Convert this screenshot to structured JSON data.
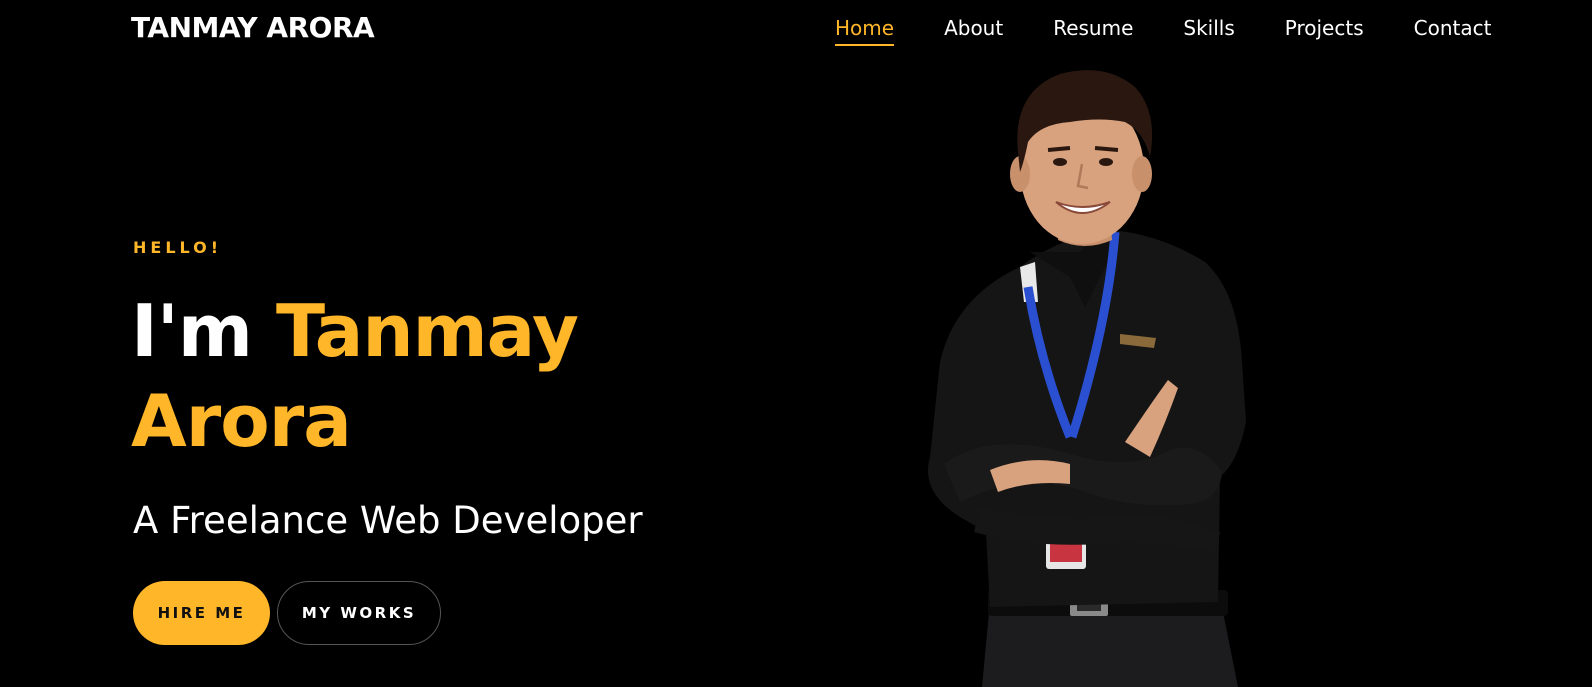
{
  "brand": {
    "name": "TANMAY ARORA"
  },
  "nav": {
    "items": [
      {
        "label": "Home",
        "active": true
      },
      {
        "label": "About",
        "active": false
      },
      {
        "label": "Resume",
        "active": false
      },
      {
        "label": "Skills",
        "active": false
      },
      {
        "label": "Projects",
        "active": false
      },
      {
        "label": "Contact",
        "active": false
      }
    ]
  },
  "hero": {
    "greeting": "HELLO!",
    "intro": "I'm",
    "name": "Tanmay Arora",
    "subtitle": "A Freelance Web Developer",
    "hire_label": "HIRE ME",
    "works_label": "MY WORKS"
  },
  "theme": {
    "background": "#000000",
    "accent": "#ffb628",
    "text": "#ffffff"
  },
  "portrait": {
    "icon": "person-photo",
    "shirt": "#151515",
    "lanyard": "#2a4fd0",
    "skin": "#d9a27f",
    "hair": "#2a1810"
  }
}
